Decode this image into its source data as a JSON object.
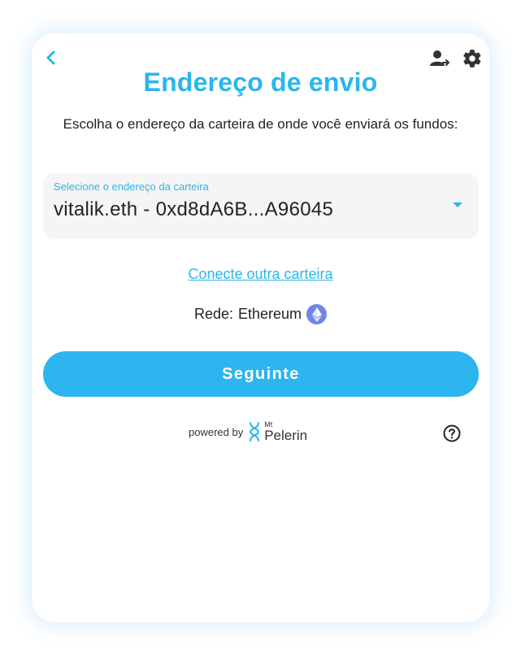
{
  "header": {
    "title": "Endereço de envio",
    "subtitle": "Escolha o endereço da carteira de onde você enviará os fundos:"
  },
  "wallet_select": {
    "label": "Selecione o endereço da carteira",
    "value": "vitalik.eth - 0xd8dA6B...A96045"
  },
  "connect_link": "Conecte outra carteira",
  "network": {
    "label": "Rede:",
    "value": "Ethereum"
  },
  "next_button": "Seguinte",
  "footer": {
    "powered_by": "powered by",
    "brand_prefix": "Mt",
    "brand_name": "Pelerin"
  },
  "colors": {
    "accent": "#2ab6ee",
    "button": "#2cb5ee",
    "eth_badge": "#6f86e6",
    "text": "#222222"
  },
  "icons": [
    "chevron-left-icon",
    "user-switch-icon",
    "gear-icon",
    "dropdown-caret-icon",
    "ethereum-icon",
    "mt-pelerin-logo",
    "help-icon"
  ]
}
